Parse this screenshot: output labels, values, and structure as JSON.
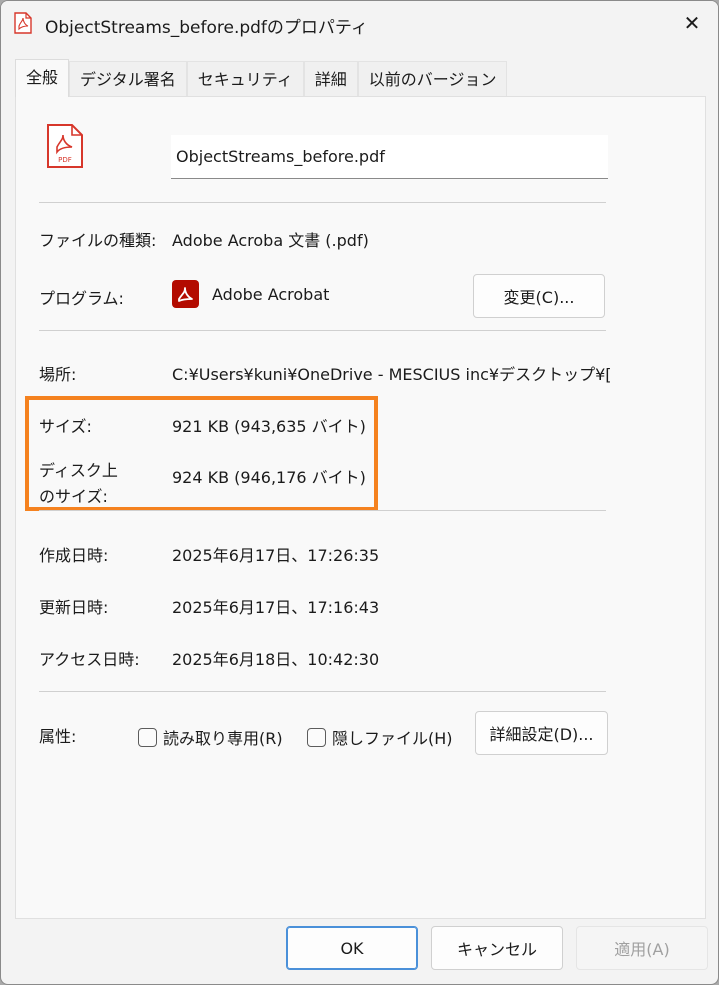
{
  "window": {
    "title": "ObjectStreams_before.pdfのプロパティ",
    "close_glyph": "✕"
  },
  "tabs": [
    {
      "label": "全般",
      "active": true
    },
    {
      "label": "デジタル署名",
      "active": false
    },
    {
      "label": "セキュリティ",
      "active": false
    },
    {
      "label": "詳細",
      "active": false
    },
    {
      "label": "以前のバージョン",
      "active": false
    }
  ],
  "general": {
    "filename": "ObjectStreams_before.pdf",
    "file_type_label": "ファイルの種類:",
    "file_type_value": "Adobe Acroba 文書 (.pdf)",
    "program_label": "プログラム:",
    "program_value": "Adobe Acrobat",
    "change_button": "変更(C)...",
    "location_label": "場所:",
    "location_value": "C:¥Users¥kuni¥OneDrive - MESCIUS inc¥デスクトップ¥[",
    "size_label": "サイズ:",
    "size_value": "921 KB (943,635 バイト)",
    "disk_size_label_1": "ディスク上",
    "disk_size_label_2": "のサイズ:",
    "disk_size_value": "924 KB (946,176 バイト)",
    "created_label": "作成日時:",
    "created_value": "2025年6月17日、17:26:35",
    "modified_label": "更新日時:",
    "modified_value": "2025年6月17日、17:16:43",
    "accessed_label": "アクセス日時:",
    "accessed_value": "2025年6月18日、10:42:30",
    "attributes_label": "属性:",
    "readonly_label": "読み取り専用(R)",
    "hidden_label": "隠しファイル(H)",
    "advanced_button": "詳細設定(D)..."
  },
  "footer": {
    "ok": "OK",
    "cancel": "キャンセル",
    "apply": "適用(A)"
  },
  "icons": {
    "pdf_file": "pdf-file-icon",
    "acrobat": "acrobat-icon",
    "close": "close-icon",
    "checkbox": "checkbox-icon"
  },
  "colors": {
    "highlight": "#f5821f",
    "acrobat_red": "#b30b00",
    "pdf_red": "#d7372b",
    "ok_border": "#4a90d9"
  }
}
